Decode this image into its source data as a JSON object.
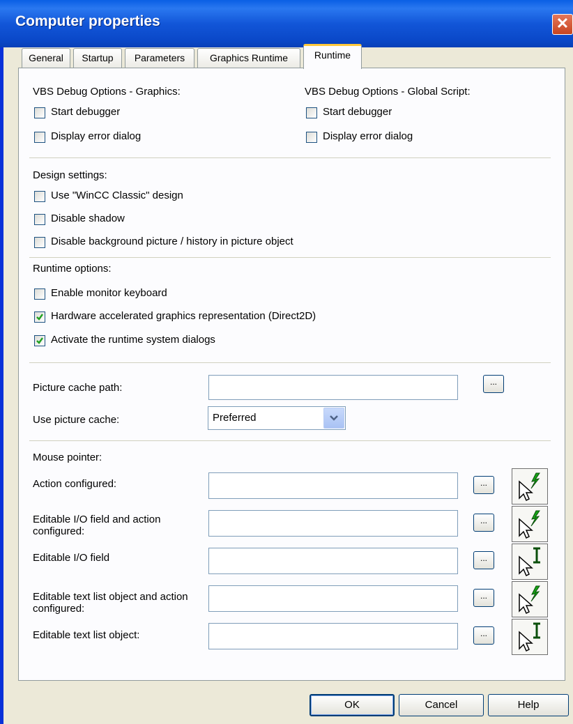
{
  "window": {
    "title": "Computer properties"
  },
  "tabs": [
    {
      "label": "General"
    },
    {
      "label": "Startup"
    },
    {
      "label": "Parameters"
    },
    {
      "label": "Graphics Runtime"
    },
    {
      "label": "Runtime",
      "active": true
    }
  ],
  "vbs_graphics": {
    "heading": "VBS Debug Options - Graphics:",
    "start_debugger": {
      "label": "Start debugger",
      "checked": false
    },
    "display_error": {
      "label": "Display error dialog",
      "checked": false
    }
  },
  "vbs_global": {
    "heading": "VBS Debug Options - Global Script:",
    "start_debugger": {
      "label": "Start debugger",
      "checked": false
    },
    "display_error": {
      "label": "Display error dialog",
      "checked": false
    }
  },
  "design": {
    "heading": "Design settings:",
    "items": [
      {
        "label": "Use \"WinCC Classic\" design",
        "checked": false
      },
      {
        "label": "Disable shadow",
        "checked": false
      },
      {
        "label": "Disable background picture / history in picture object",
        "checked": false
      }
    ]
  },
  "runtime_options": {
    "heading": "Runtime options:",
    "items": [
      {
        "label": "Enable monitor keyboard",
        "checked": false
      },
      {
        "label": "Hardware accelerated graphics representation (Direct2D)",
        "checked": true
      },
      {
        "label": "Activate the runtime system dialogs",
        "checked": true
      }
    ]
  },
  "picture_cache": {
    "path_label": "Picture cache path:",
    "path_value": "",
    "use_label": "Use picture cache:",
    "use_value": "Preferred"
  },
  "mouse_pointer": {
    "heading": "Mouse pointer:",
    "rows": [
      {
        "label": "Action configured:",
        "value": "",
        "icon": "action-cursor-icon"
      },
      {
        "label": "Editable I/O field and action configured:",
        "value": "",
        "icon": "action-cursor-icon"
      },
      {
        "label": "Editable I/O field",
        "value": "",
        "icon": "edit-cursor-icon"
      },
      {
        "label": "Editable text list object and action configured:",
        "value": "",
        "icon": "action-cursor-icon"
      },
      {
        "label": "Editable text list object:",
        "value": "",
        "icon": "edit-cursor-icon"
      }
    ]
  },
  "buttons": {
    "browse": "...",
    "ok": "OK",
    "cancel": "Cancel",
    "help": "Help"
  },
  "colors": {
    "title_bar": "#0a5fe4",
    "dialog_bg": "#ece9d8",
    "check_green": "#21a121",
    "tab_highlight": "#ffc83c"
  }
}
